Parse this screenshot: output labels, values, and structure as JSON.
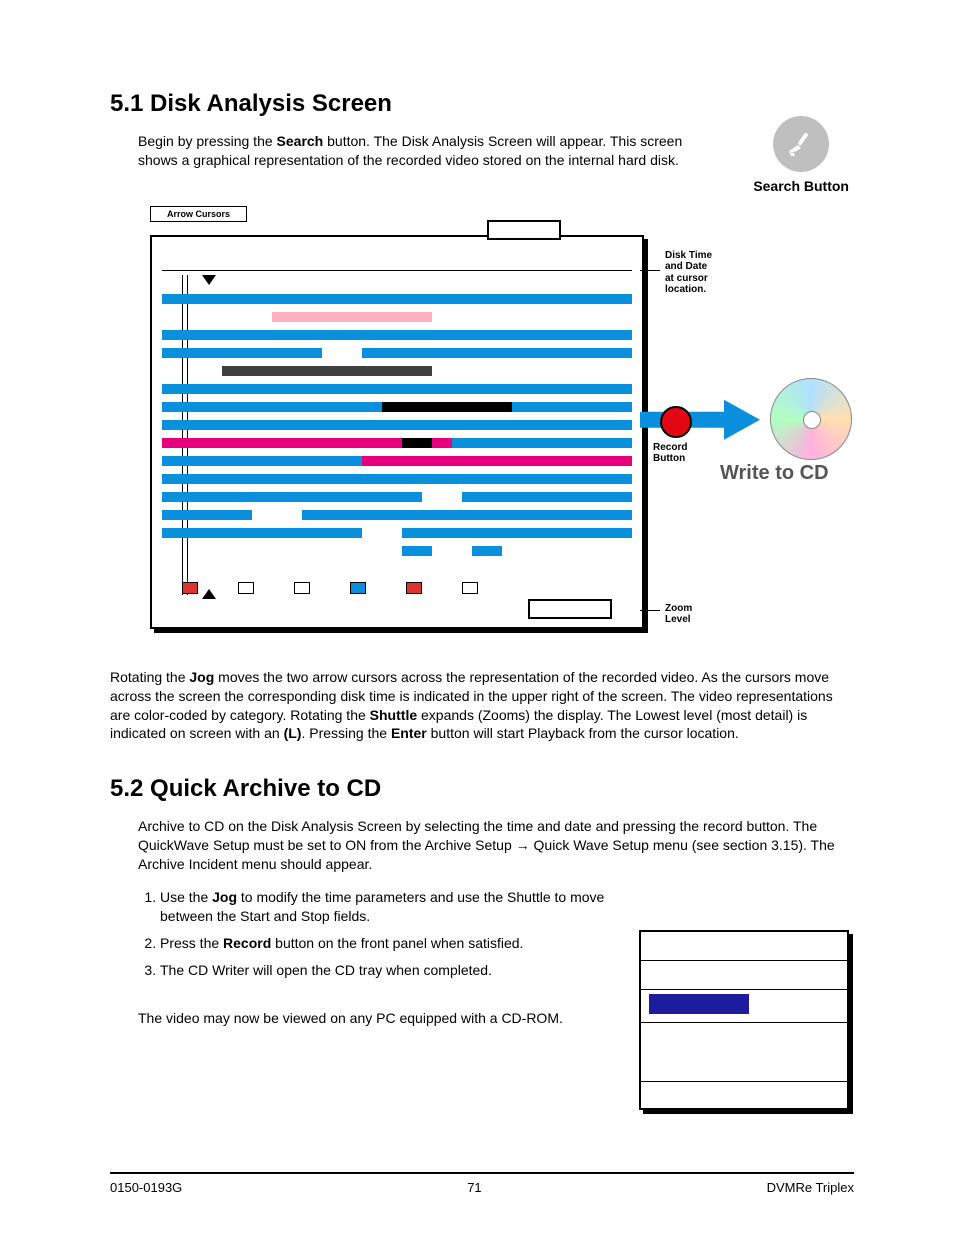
{
  "section1": {
    "heading": "5.1 Disk Analysis Screen",
    "intro_pre": "Begin by pressing the ",
    "intro_bold": "Search",
    "intro_post": " button.  The Disk Analysis Screen will appear. This screen shows a graphical representation of the recorded video stored on the internal hard disk.",
    "search_label": "Search Button"
  },
  "diagram": {
    "arrow_cursors": "Arrow Cursors",
    "disk_time": "Disk Time\nand Date\nat cursor\nlocation.",
    "record_button": "Record\nButton",
    "write_to_cd": "Write to CD",
    "zoom_level": "Zoom\nLevel"
  },
  "body1": {
    "p1": "Rotating the ",
    "jog": "Jog",
    "p2": " moves the two arrow cursors across the representation of the recorded video. As the cursors move across the screen the corresponding disk time is indicated in the upper right of the screen. The video representations are color-coded by category. Rotating the ",
    "shuttle": "Shuttle",
    "p3": " expands (Zooms) the display. The Lowest level (most detail) is indicated on screen with an ",
    "L": "(L)",
    "p4": ". Pressing the ",
    "enter": "Enter",
    "p5": " button will start Playback from the cursor location."
  },
  "section2": {
    "heading": "5.2 Quick Archive to CD",
    "intro": "Archive to CD on the Disk Analysis Screen by selecting the time and date and pressing the record button. The QuickWave Setup must be set to ON from the Archive Setup → Quick Wave Setup menu (see section 3.15). The Archive Incident menu should appear.",
    "li1a": "Use the ",
    "li1_jog": "Jog",
    "li1b": " to modify the time parameters and use the Shuttle to move between the Start and Stop fields.",
    "li2a": "Press the ",
    "li2_record": "Record",
    "li2b": " button on the front panel when satisfied.",
    "li3": "The CD Writer will open the CD tray when completed.",
    "after": "The video may now be viewed on any PC equipped with a CD-ROM."
  },
  "footer": {
    "left": "0150-0193G",
    "center": "71",
    "right": "DVMRe Triplex"
  }
}
